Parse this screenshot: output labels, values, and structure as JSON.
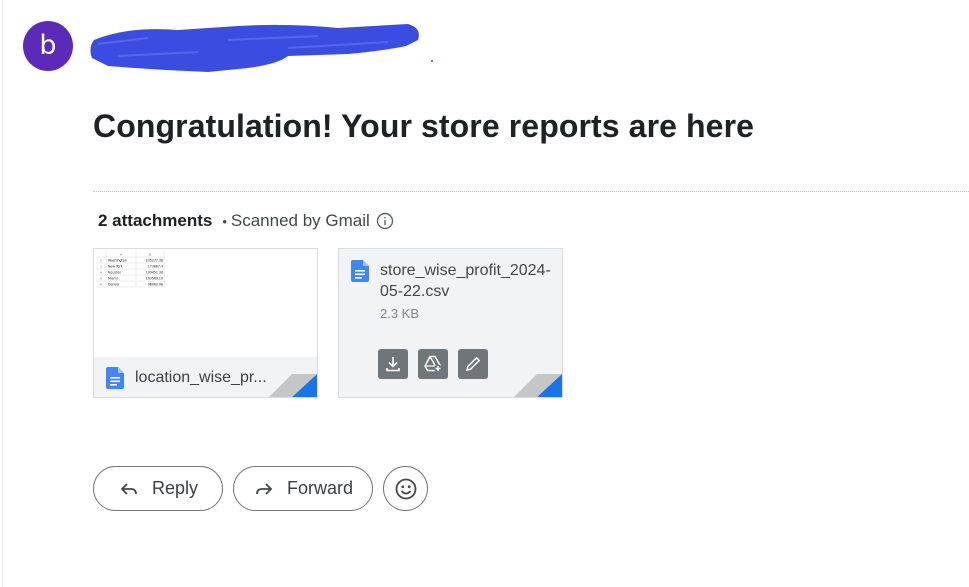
{
  "sender": {
    "avatar_letter": "b",
    "avatar_color": "#5b2ab8",
    "redaction_color": "#3b4de0"
  },
  "message": {
    "subject": "Congratulation! Your store reports are here"
  },
  "attachments": {
    "count_label": "2 attachments",
    "separator": "•",
    "scanned_label": "Scanned by Gmail",
    "items": [
      {
        "name": "location_wise_pr...",
        "thumbnail": {
          "col_headers": [
            "A",
            "B"
          ],
          "rows": [
            {
              "num": "1",
              "a": "",
              "b": ""
            },
            {
              "num": "2",
              "a": "Washington",
              "b": "235277.38"
            },
            {
              "num": "3",
              "a": "New York",
              "b": "173867.4"
            },
            {
              "num": "4",
              "a": "Houston",
              "b": "109452.38"
            },
            {
              "num": "5",
              "a": "Miami",
              "b": "103569.10"
            },
            {
              "num": "6",
              "a": "Denver",
              "b": "96062.98"
            }
          ]
        }
      },
      {
        "name": "store_wise_profit_2024-05-22.csv",
        "size": "2.3 KB"
      }
    ]
  },
  "actions": {
    "reply_label": "Reply",
    "forward_label": "Forward"
  },
  "colors": {
    "doc_blue": "#4285f4",
    "fold_blue": "#1a73e8",
    "fold_gray": "#c4c7c5",
    "action_gray": "#70757a"
  }
}
